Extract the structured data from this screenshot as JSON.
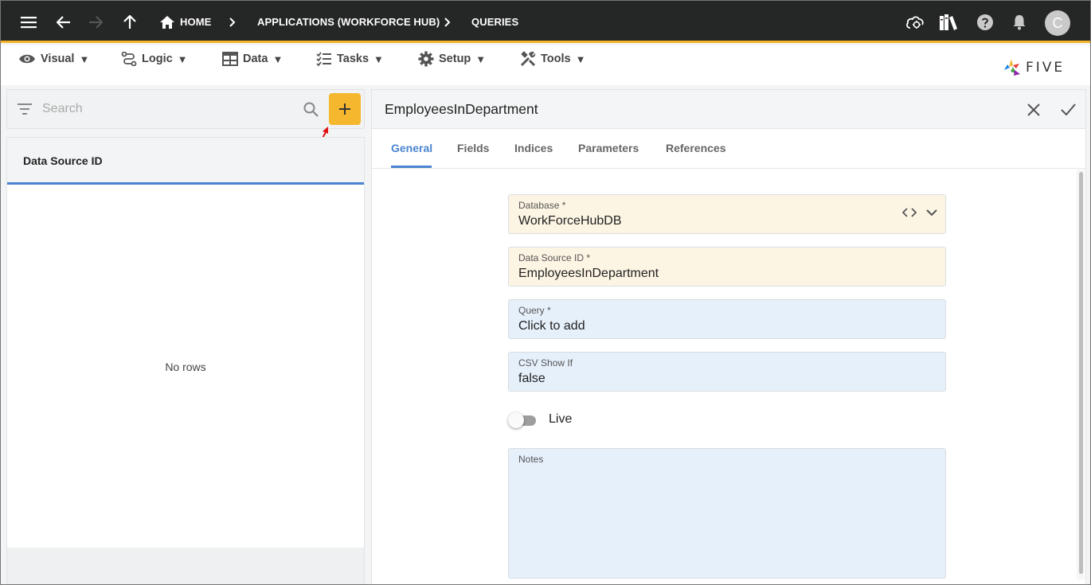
{
  "topbar": {
    "breadcrumbs": [
      "HOME",
      "APPLICATIONS (WORKFORCE HUB)",
      "QUERIES"
    ],
    "icons": [
      "menu-icon",
      "back-arrow-icon",
      "forward-arrow-icon",
      "up-arrow-icon",
      "home-icon",
      "cloud-icon",
      "library-icon",
      "help-icon",
      "bell-icon"
    ],
    "avatar_initial": "C"
  },
  "menu": {
    "items": [
      {
        "label": "Visual",
        "icon": "eye-icon"
      },
      {
        "label": "Logic",
        "icon": "logic-icon"
      },
      {
        "label": "Data",
        "icon": "table-icon"
      },
      {
        "label": "Tasks",
        "icon": "checklist-icon"
      },
      {
        "label": "Setup",
        "icon": "gear-icon"
      },
      {
        "label": "Tools",
        "icon": "tools-icon"
      }
    ],
    "caret": "▼",
    "brand": "FIVE"
  },
  "left": {
    "search_placeholder": "Search",
    "column_header": "Data Source ID",
    "empty_text": "No rows"
  },
  "form": {
    "title": "EmployeesInDepartment",
    "tabs": [
      "General",
      "Fields",
      "Indices",
      "Parameters",
      "References"
    ],
    "active_tab": "General",
    "fields": {
      "database": {
        "label": "Database *",
        "value": "WorkForceHubDB"
      },
      "data_source_id": {
        "label": "Data Source ID *",
        "value": "EmployeesInDepartment"
      },
      "query": {
        "label": "Query *",
        "value": "Click to add"
      },
      "csv_show_if": {
        "label": "CSV Show If",
        "value": "false"
      },
      "live": {
        "label": "Live",
        "checked": false
      },
      "notes": {
        "label": "Notes",
        "value": ""
      }
    }
  },
  "colors": {
    "topbar_bg": "#252626",
    "accent_yellow": "#f5b72d",
    "tab_blue": "#4a84d0",
    "required_field_bg": "#fdf5e4",
    "field_bg": "#e6f0fb"
  }
}
